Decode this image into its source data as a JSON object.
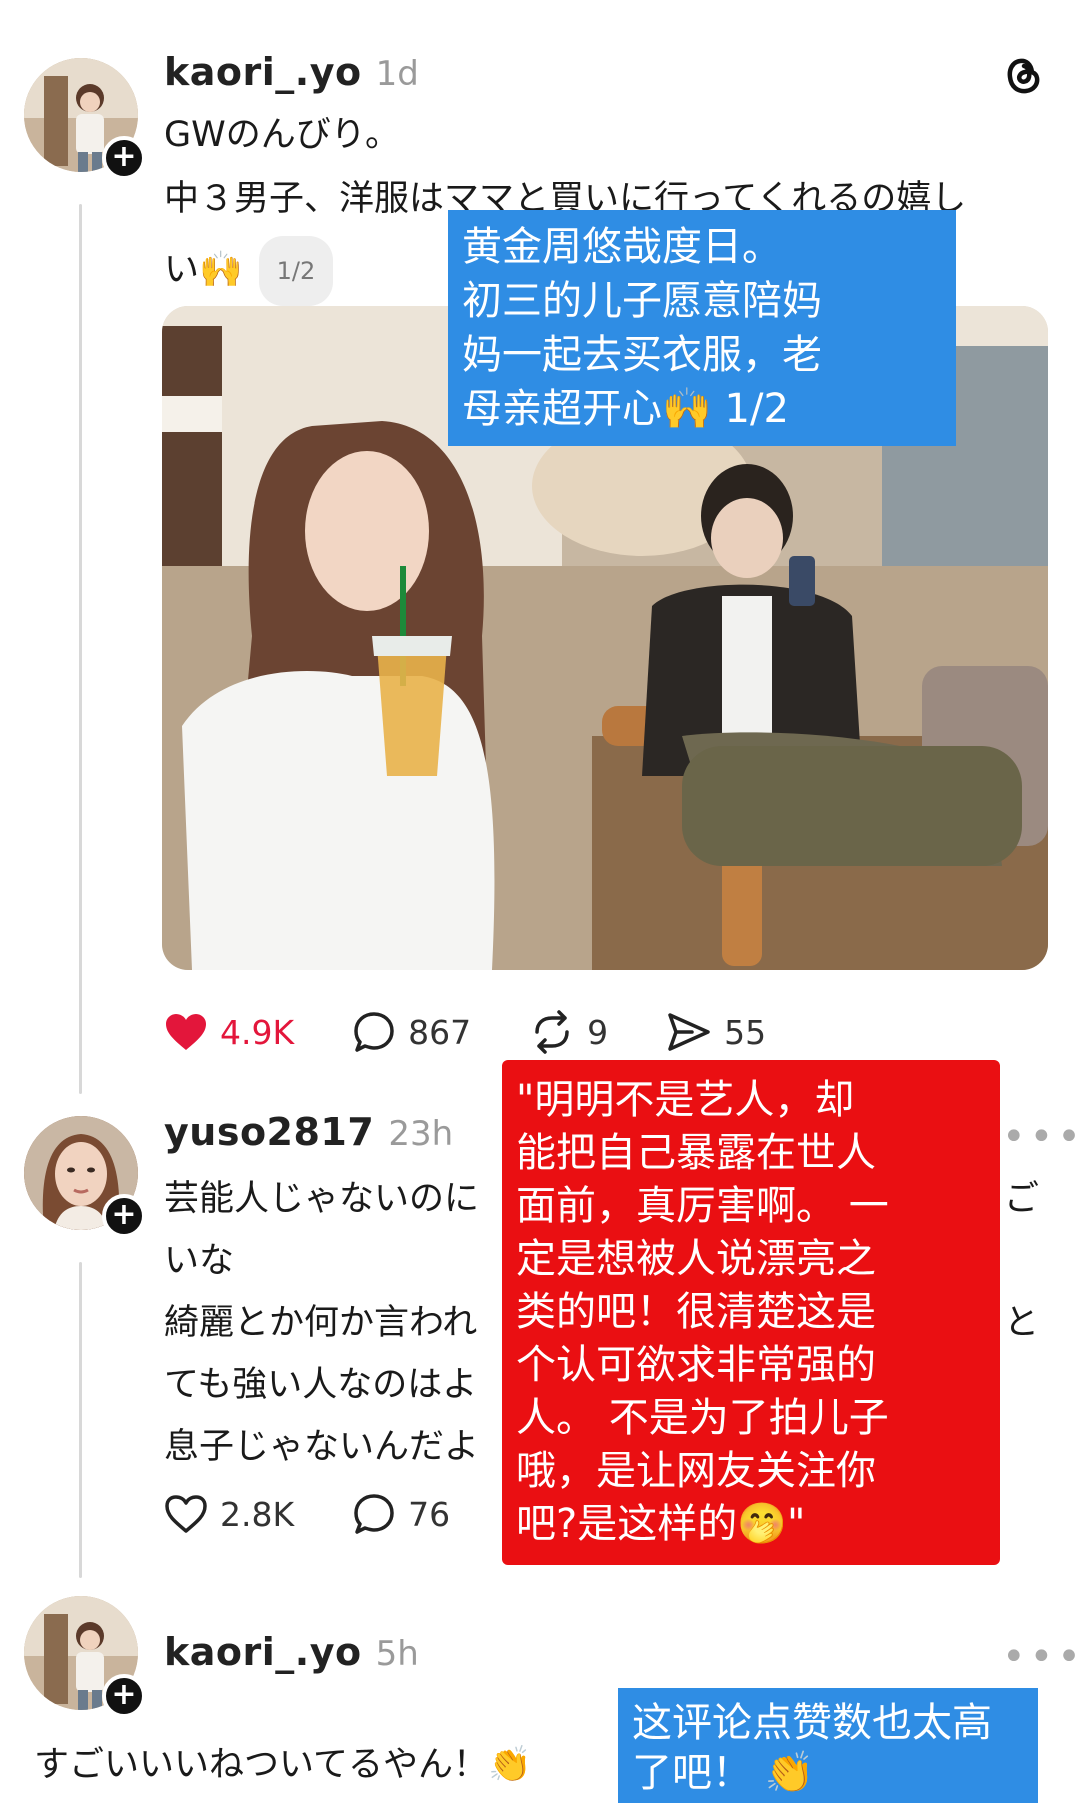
{
  "post": {
    "username": "kaori_.yo",
    "time": "1d",
    "lines": [
      "GWのんびり。",
      "中３男子、洋服はママと買いに行ってくれるの嬉し",
      "い🙌"
    ],
    "pager": "1/2",
    "likes": "4.9K",
    "comments": "867",
    "reposts": "9",
    "shares": "55"
  },
  "overlay_top": {
    "text_lines": [
      "黄金周悠哉度日。",
      "初三的儿子愿意陪妈",
      "妈一起去买衣服，老",
      "母亲超开心🙌 1/2"
    ]
  },
  "reply1": {
    "username": "yuso2817",
    "time": "23h",
    "lines": [
      "芸能人じゃないのに",
      "ご",
      "いな",
      "綺麗とか何か言われ",
      "と",
      "ても強い人なのはよ",
      "息子じゃないんだよ"
    ],
    "likes": "2.8K",
    "comments": "76",
    "more": "•••"
  },
  "overlay_red": {
    "text_lines": [
      "\"明明不是艺人，却",
      "能把自己暴露在世人",
      "面前，真厉害啊。 一",
      "定是想被人说漂亮之",
      "类的吧！很清楚这是",
      "个认可欲求非常强的",
      "人。 不是为了拍儿子",
      "哦，是让网友关注你",
      "吧?是这样的🤭\""
    ]
  },
  "reply2": {
    "username": "kaori_.yo",
    "time": "5h",
    "text": "すごいいいねついてるやん！👏",
    "more": "•••"
  },
  "overlay_bottom": {
    "text_lines": [
      "这评论点赞数也太高",
      "了吧！ 👏"
    ]
  },
  "colors": {
    "like_red": "#e3163b",
    "overlay_blue": "#2f8de4",
    "overlay_red": "#ea0f12"
  },
  "icons": [
    "threads-logo-icon",
    "heart-filled-icon",
    "comment-icon",
    "repost-icon",
    "share-icon",
    "heart-outline-icon",
    "more-icon",
    "plus-icon"
  ]
}
